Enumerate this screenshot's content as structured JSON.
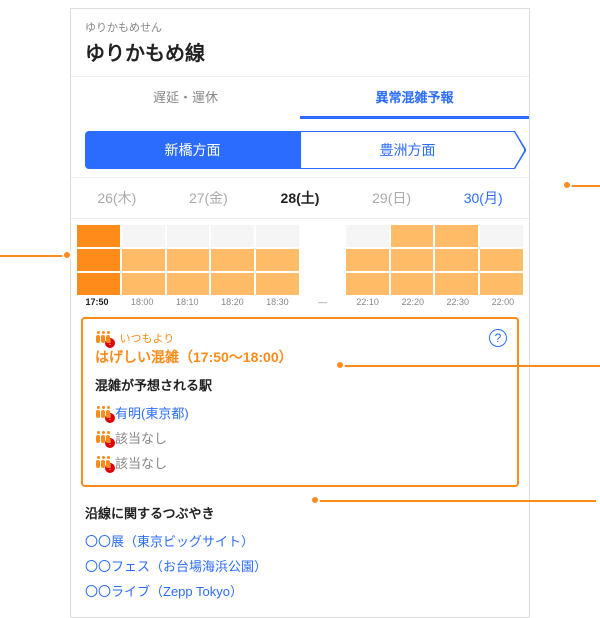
{
  "header": {
    "kana": "ゆりかもめせん",
    "name": "ゆりかもめ線"
  },
  "tabs": {
    "delay": "遅延・運休",
    "forecast": "異常混雑予報"
  },
  "directions": {
    "a": "新橋方面",
    "b": "豊洲方面"
  },
  "dates": [
    {
      "label": "26(木)"
    },
    {
      "label": "27(金)"
    },
    {
      "label": "28(土)"
    },
    {
      "label": "29(日)"
    },
    {
      "label": "30(月)"
    }
  ],
  "times": [
    "17:50",
    "18:00",
    "18:10",
    "18:20",
    "18:30",
    "—",
    "22:10",
    "22:20",
    "22:30",
    "22:00"
  ],
  "congestion": {
    "prefix": "いつもより",
    "main": "はげしい混雑（17:50〜18:00）",
    "help": "?",
    "stations_title": "混雑が予想される駅",
    "stations": [
      {
        "name": "有明(東京都)",
        "link": true
      },
      {
        "name": "該当なし",
        "link": false
      },
      {
        "name": "該当なし",
        "link": false
      }
    ]
  },
  "tweets": {
    "title": "沿線に関するつぶやき",
    "items": [
      "〇〇展（東京ビッグサイト）",
      "〇〇フェス（お台場海浜公園）",
      "〇〇ライブ（Zepp Tokyo）"
    ]
  }
}
